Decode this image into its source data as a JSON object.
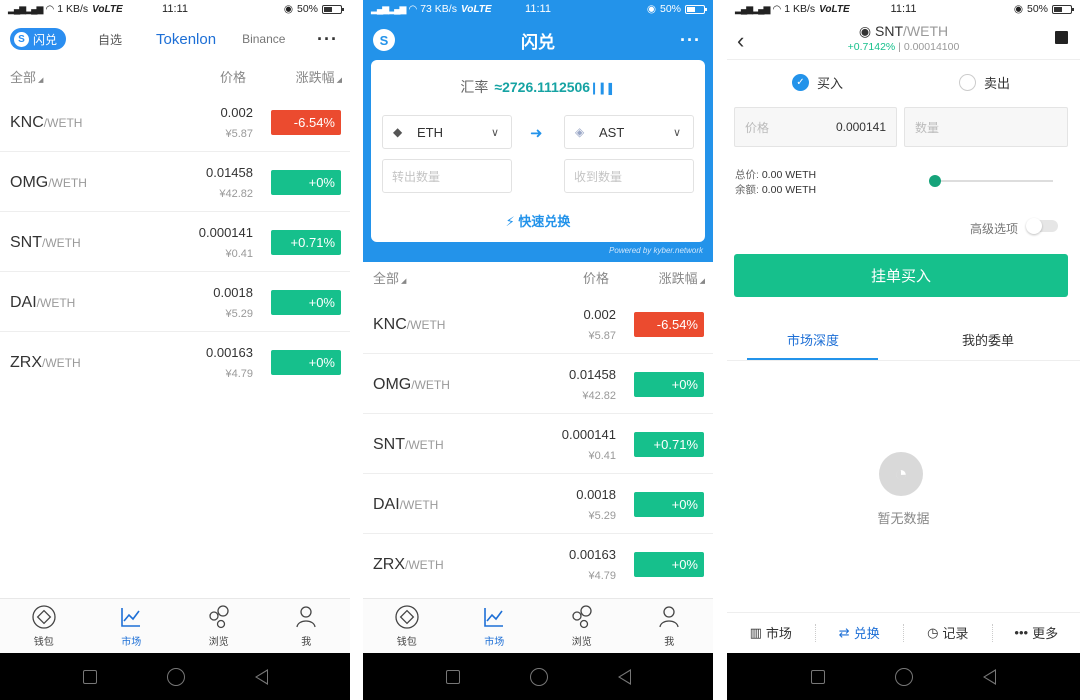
{
  "status_left": {
    "time": "11:11",
    "speed": "1 KB/s",
    "volte": "VoLTE",
    "battery": "50%"
  },
  "status_mid": {
    "time": "11:11",
    "speed": "73 KB/s",
    "volte": "VoLTE",
    "battery": "50%"
  },
  "status_right": {
    "time": "11:11",
    "speed": "1 KB/s",
    "volte": "VoLTE",
    "battery": "50%"
  },
  "screen1": {
    "pill_label": "闪兑",
    "tabs": [
      "自选",
      "Tokenlon",
      "Binance"
    ],
    "active_tab": "Tokenlon",
    "more": "···"
  },
  "market": {
    "col_all": "全部",
    "col_price": "价格",
    "col_change": "涨跌幅",
    "rows": [
      {
        "symbol": "KNC",
        "quote": "/WETH",
        "price": "0.002",
        "cny": "¥5.87",
        "change": "-6.54%",
        "direction": "down"
      },
      {
        "symbol": "OMG",
        "quote": "/WETH",
        "price": "0.01458",
        "cny": "¥42.82",
        "change": "+0%",
        "direction": "up"
      },
      {
        "symbol": "SNT",
        "quote": "/WETH",
        "price": "0.000141",
        "cny": "¥0.41",
        "change": "+0.71%",
        "direction": "up"
      },
      {
        "symbol": "DAI",
        "quote": "/WETH",
        "price": "0.0018",
        "cny": "¥5.29",
        "change": "+0%",
        "direction": "up"
      },
      {
        "symbol": "ZRX",
        "quote": "/WETH",
        "price": "0.00163",
        "cny": "¥4.79",
        "change": "+0%",
        "direction": "up"
      }
    ]
  },
  "bottom_nav": [
    {
      "label": "钱包",
      "icon": "wallet-icon"
    },
    {
      "label": "市场",
      "icon": "market-chart-icon",
      "active": true
    },
    {
      "label": "浏览",
      "icon": "browse-icon"
    },
    {
      "label": "我",
      "icon": "person-icon"
    }
  ],
  "screen2": {
    "title": "闪兑",
    "more": "···",
    "rate_label": "汇率",
    "rate_value": "≈2726.1112506",
    "from_token": "ETH",
    "to_token": "AST",
    "from_placeholder": "转出数量",
    "to_placeholder": "收到数量",
    "quick_label": "快速兑换",
    "powered": "Powered by  kyber.network"
  },
  "screen3": {
    "pair_symbol": "SNT",
    "pair_quote": "/WETH",
    "change": "+0.7142%",
    "last_price": " | 0.00014100",
    "buy_label": "买入",
    "sell_label": "卖出",
    "price_placeholder": "价格",
    "price_value": "0.000141",
    "qty_placeholder": "数量",
    "total_label": "总价:",
    "total_value": "0.00 WETH",
    "balance_label": "余额:",
    "balance_value": "0.00 WETH",
    "slider_level": 0,
    "advanced_label": "高级选项",
    "submit_label": "挂单买入",
    "depth_tab": "市场深度",
    "orders_tab": "我的委单",
    "empty_text": "暂无数据",
    "nav": [
      {
        "label": "市场",
        "icon": "bar-chart-icon"
      },
      {
        "label": "兑换",
        "icon": "swap-icon",
        "active": true
      },
      {
        "label": "记录",
        "icon": "clock-icon"
      },
      {
        "label": "更多",
        "icon": "more-dots-icon"
      }
    ]
  },
  "colors": {
    "accent": "#2393ea",
    "up": "#16c08c",
    "down": "#eb4b2f"
  }
}
